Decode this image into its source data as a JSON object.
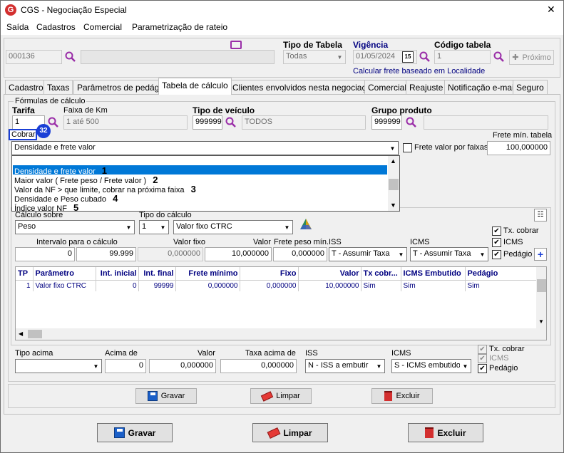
{
  "window": {
    "title": "CGS - Negociação Especial",
    "close": "✕"
  },
  "menu": [
    "Saída",
    "Cadastros",
    "Comercial",
    "Parametrização de rateio"
  ],
  "header": {
    "client_code": "000136",
    "tipo_tabela_label": "Tipo de Tabela",
    "tipo_tabela_value": "Todas",
    "vigencia_label": "Vigência",
    "vigencia_value": "01/05/2024",
    "codigo_tabela_label": "Código tabela",
    "codigo_tabela_value": "1",
    "proximo_label": "Próximo",
    "calc_link": "Calcular frete baseado em Localidade"
  },
  "tabs": [
    "Cadastro",
    "Taxas",
    "Parâmetros de pedágio",
    "Tabela de cálculo",
    "Clientes envolvidos nesta negociação",
    "Comercial",
    "Reajuste",
    "Notificação e-mail",
    "Seguro"
  ],
  "formulas": {
    "group_label": "Fórmulas de cálculo",
    "tarifa_label": "Tarifa",
    "tarifa_value": "1",
    "faixa_label": "Faixa de Km",
    "faixa_value": "1 até 500",
    "tipo_veiculo_label": "Tipo de veículo",
    "tipo_veiculo_code": "999999",
    "tipo_veiculo_value": "TODOS",
    "grupo_produto_label": "Grupo produto",
    "grupo_produto_code": "999999",
    "cobrar_label": "Cobrar",
    "badge": "32",
    "cobrar_value": "Densidade e frete valor",
    "frete_faixas_label": "Frete valor por faixas",
    "frete_min_label": "Frete mín. tabela",
    "frete_min_value": "100,000000"
  },
  "dropdown": {
    "items": [
      "Densidade e frete valor",
      "Maior valor ( Frete peso / Frete valor )",
      "Valor da NF > que limite, cobrar na próxima faixa",
      "Densidade e Peso cubado",
      "Índice valor NF"
    ],
    "numbers": [
      "1",
      "2",
      "3",
      "4",
      "5"
    ]
  },
  "calc": {
    "calculo_sobre_label": "Cálculo sobre",
    "calculo_sobre_value": "Peso",
    "tipo_calculo_label": "Tipo do cálculo",
    "tipo_calculo_num": "1",
    "tipo_calculo_value": "Valor fixo CTRC",
    "intervalo_label": "Intervalo para o cálculo",
    "intervalo_de": "0",
    "intervalo_ate": "99.999",
    "valor_fixo_label": "Valor fixo",
    "valor_fixo_value": "0,000000",
    "valor_label": "Valor",
    "valor_value": "10,000000",
    "frete_peso_label": "Frete peso mín.",
    "frete_peso_value": "0,000000",
    "iss_label": "ISS",
    "iss_value": "T - Assumir Taxa",
    "icms_label": "ICMS",
    "icms_value": "T - Assumir Taxa",
    "tx_cobrar": "Tx. cobrar",
    "icms_chk": "ICMS",
    "pedagio": "Pedágio"
  },
  "grid": {
    "columns": [
      "TP",
      "Parâmetro",
      "Int. inicial",
      "Int. final",
      "Frete mínimo",
      "Fixo",
      "Valor",
      "Tx cobr...",
      "ICMS Embutido",
      "Pedágio"
    ],
    "rows": [
      [
        "1",
        "Valor fixo CTRC",
        "0",
        "99999",
        "0,000000",
        "0,000000",
        "10,000000",
        "Sim",
        "Sim",
        "Sim"
      ]
    ]
  },
  "bottom": {
    "tipo_acima_label": "Tipo acima",
    "acima_de_label": "Acima de",
    "acima_de_value": "0",
    "valor_label": "Valor",
    "valor_value": "0,000000",
    "taxa_acima_label": "Taxa acima de",
    "taxa_acima_value": "0,000000",
    "iss_label": "ISS",
    "iss_value": "N - ISS a embutir",
    "icms_label": "ICMS",
    "icms_value": "S - ICMS embutido",
    "tx_cobrar": "Tx. cobrar",
    "icms_chk": "ICMS",
    "pedagio": "Pedágio"
  },
  "buttons": {
    "gravar": "Gravar",
    "limpar": "Limpar",
    "excluir": "Excluir"
  },
  "colors": {
    "accent": "#0078d7",
    "badge": "#1a3fd6",
    "link": "#000080",
    "icon_purple": "#9a2ea8"
  }
}
